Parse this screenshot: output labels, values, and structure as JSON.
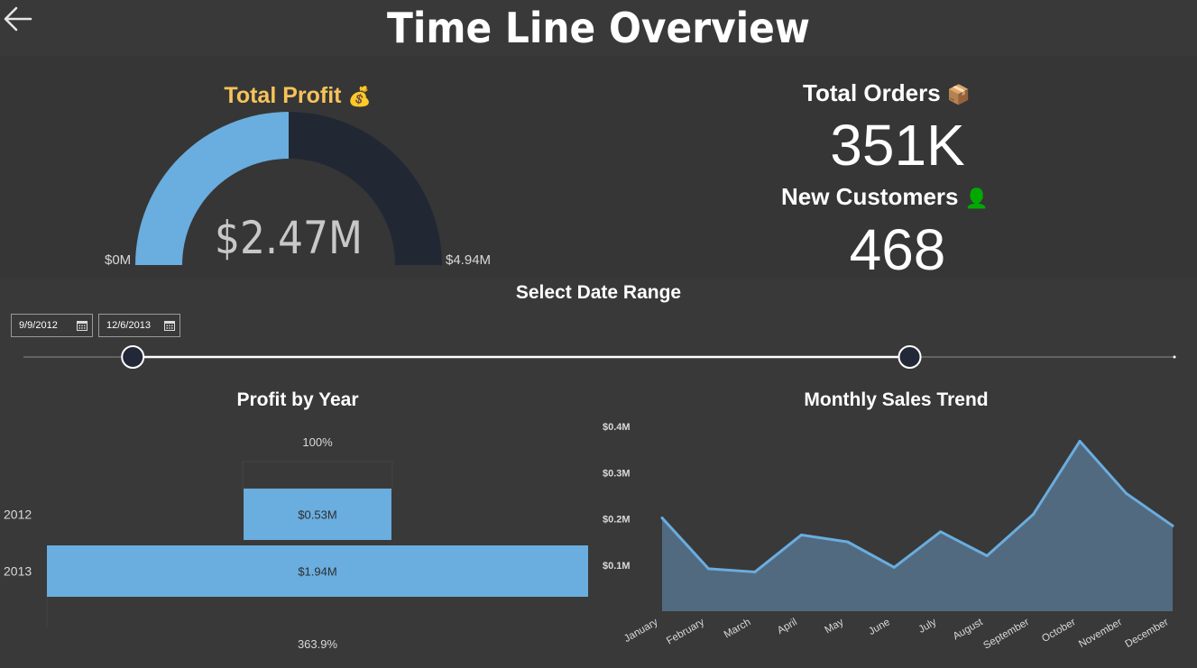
{
  "header": {
    "title": "Time Line Overview",
    "back_icon": "arrow-left-icon"
  },
  "gauge": {
    "title": "Total Profit",
    "emoji": "💰",
    "value_label": "$2.47M",
    "min_label": "$0M",
    "max_label": "$4.94M",
    "value": 2.47,
    "max": 4.94,
    "colors": {
      "fill": "#6aaddf",
      "track": "#222833"
    }
  },
  "kpis": {
    "orders": {
      "label": "Total Orders",
      "emoji": "📦",
      "value": "351K"
    },
    "customers": {
      "label": "New Customers",
      "emoji": "👤",
      "value": "468"
    }
  },
  "date_range": {
    "title": "Select Date Range",
    "start": "9/9/2012",
    "end": "12/6/2013",
    "start_fraction": 0.095,
    "end_fraction": 0.77
  },
  "profit_by_year": {
    "title": "Profit by Year",
    "top_label": "100%",
    "bottom_label": "363.9%"
  },
  "monthly_sales": {
    "title": "Monthly Sales Trend"
  },
  "chart_data": [
    {
      "type": "bar",
      "title": "Profit by Year",
      "categories": [
        "2012",
        "2013"
      ],
      "values": [
        0.53,
        1.94
      ],
      "value_labels": [
        "$0.53M",
        "$1.94M"
      ],
      "color": "#6aaddf"
    },
    {
      "type": "area",
      "title": "Monthly Sales Trend",
      "categories": [
        "January",
        "February",
        "March",
        "April",
        "May",
        "June",
        "July",
        "August",
        "September",
        "October",
        "November",
        "December"
      ],
      "values": [
        0.202,
        0.092,
        0.085,
        0.165,
        0.15,
        0.095,
        0.172,
        0.12,
        0.21,
        0.368,
        0.255,
        0.185
      ],
      "y_ticks": [
        0.1,
        0.2,
        0.3,
        0.4
      ],
      "y_tick_labels": [
        "$0.1M",
        "$0.2M",
        "$0.3M",
        "$0.4M"
      ],
      "ylim": [
        0.0,
        0.4
      ],
      "grid": false,
      "line_color": "#6aaddf",
      "fill_color": "#526a80"
    }
  ]
}
